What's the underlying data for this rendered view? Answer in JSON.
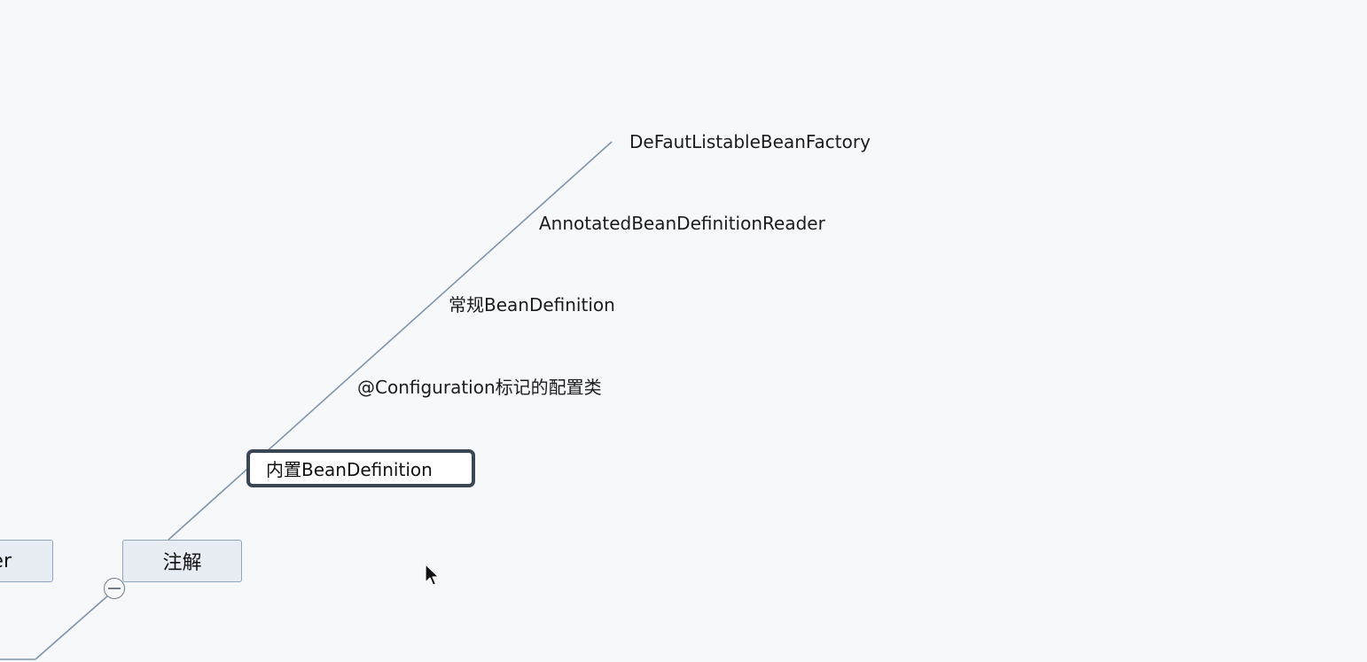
{
  "map": {
    "left_node_label": "er",
    "parent_node_label": "注解",
    "selected_child_label": "内置BeanDefinition",
    "children": [
      {
        "label": "DeFautListableBeanFactory"
      },
      {
        "label": "AnnotatedBeanDefinitionReader"
      },
      {
        "label": "常规BeanDefinition"
      },
      {
        "label": "@Configuration标记的配置类"
      }
    ]
  },
  "icons": {
    "collapse": "minus-circle-icon",
    "cursor": "mouse-pointer-icon"
  },
  "colors": {
    "background": "#f7f8fa",
    "connector": "#7f95ab",
    "node_fill": "#e8edf3",
    "node_border": "#8ea6bf",
    "selected_border": "#3a4653"
  }
}
